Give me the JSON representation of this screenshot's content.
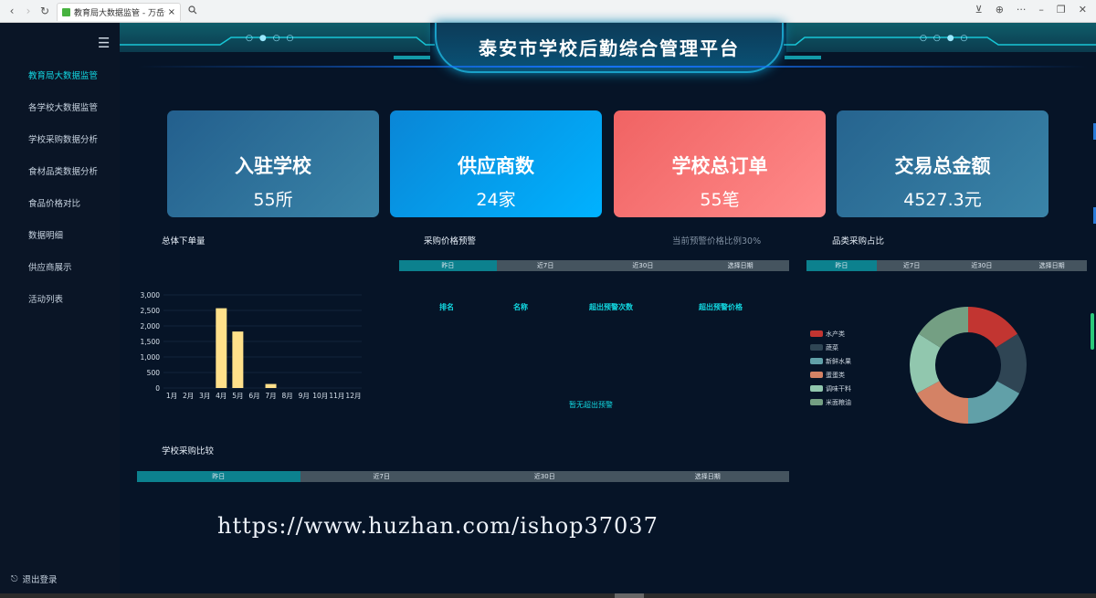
{
  "browser": {
    "tab_title": "教育局大数据监管 - 万岳食堂",
    "close_glyph": "×",
    "back": "‹",
    "forward": "›",
    "reload": "↻",
    "search_icon": "search-icon",
    "download_glyph": "⊻",
    "globe_glyph": "⊕",
    "more_glyph": "···",
    "minimize_glyph": "–",
    "restore_glyph": "❐",
    "close_window_glyph": "✕"
  },
  "sidebar": {
    "menu_glyph": "☰",
    "items": [
      {
        "label": "教育局大数据监管",
        "active": true
      },
      {
        "label": "各学校大数据监管",
        "active": false
      },
      {
        "label": "学校采购数据分析",
        "active": false
      },
      {
        "label": "食材品类数据分析",
        "active": false
      },
      {
        "label": "食品价格对比",
        "active": false
      },
      {
        "label": "数据明细",
        "active": false
      },
      {
        "label": "供应商展示",
        "active": false
      },
      {
        "label": "活动列表",
        "active": false
      }
    ],
    "logout_label": "退出登录",
    "logout_glyph": "⎋"
  },
  "header": {
    "title": "泰安市学校后勤综合管理平台",
    "dots_left": "○●○○",
    "dots_right": "○○●○"
  },
  "cards": [
    {
      "label": "入驻学校",
      "value": "55所",
      "color": "#235f8d"
    },
    {
      "label": "供应商数",
      "value": "24家",
      "color": "#0a86d6"
    },
    {
      "label": "学校总订单",
      "value": "55笔",
      "color": "#f06363"
    },
    {
      "label": "交易总金额",
      "value": "4527.3元",
      "color": "#26648f"
    }
  ],
  "orders": {
    "title": "总体下单量"
  },
  "price_alert": {
    "title": "采购价格预警",
    "subtitle": "当前预警价格比例30%",
    "tabs": [
      "昨日",
      "近7日",
      "近30日",
      "选择日期"
    ],
    "columns": [
      "排名",
      "名称",
      "超出预警次数",
      "超出预警价格"
    ],
    "empty_text": "暂无超出预警"
  },
  "category": {
    "title": "品类采购占比",
    "tabs": [
      "昨日",
      "近7日",
      "近30日",
      "选择日期"
    ]
  },
  "school_compare": {
    "title": "学校采购比较",
    "tabs": [
      "昨日",
      "近7日",
      "近30日",
      "选择日期"
    ]
  },
  "watermark": "https://www.huzhan.com/ishop37037",
  "chart_data": [
    {
      "type": "bar",
      "categories": [
        "1月",
        "2月",
        "3月",
        "4月",
        "5月",
        "6月",
        "7月",
        "8月",
        "9月",
        "10月",
        "11月",
        "12月"
      ],
      "values": [
        0,
        0,
        0,
        2570,
        1820,
        0,
        130,
        0,
        0,
        0,
        0,
        0
      ],
      "ylim": [
        0,
        3000
      ],
      "yticks": [
        "0",
        "500",
        "1,000",
        "1,500",
        "2,000",
        "2,500",
        "3,000"
      ],
      "bar_color": "#ffe08a",
      "grid": true
    },
    {
      "type": "pie",
      "donut": true,
      "labels": [
        "水产类",
        "蔬菜",
        "新鲜水果",
        "蛋蛋类",
        "调味干料",
        "米面粮油"
      ],
      "values": [
        16,
        17,
        17,
        17,
        17,
        16
      ],
      "colors": [
        "#c23531",
        "#2f4554",
        "#61a0a8",
        "#d48265",
        "#91c7ae",
        "#749f83"
      ],
      "legend": "left"
    }
  ]
}
